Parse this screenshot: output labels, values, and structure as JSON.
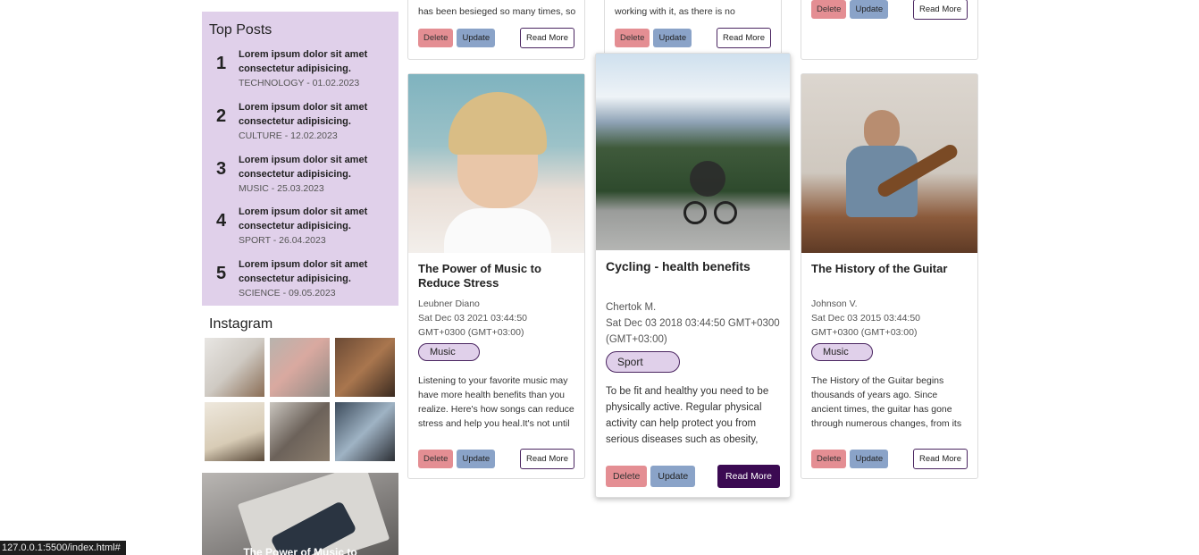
{
  "top_posts": {
    "heading": "Top Posts",
    "items": [
      {
        "num": "1",
        "title": "Lorem ipsum dolor sit amet consectetur adipisicing.",
        "meta": "TECHNOLOGY - 01.02.2023"
      },
      {
        "num": "2",
        "title": "Lorem ipsum dolor sit amet consectetur adipisicing.",
        "meta": "CULTURE - 12.02.2023"
      },
      {
        "num": "3",
        "title": "Lorem ipsum dolor sit amet consectetur adipisicing.",
        "meta": "MUSIC - 25.03.2023"
      },
      {
        "num": "4",
        "title": "Lorem ipsum dolor sit amet consectetur adipisicing.",
        "meta": "SPORT - 26.04.2023"
      },
      {
        "num": "5",
        "title": "Lorem ipsum dolor sit amet consectetur adipisicing.",
        "meta": "SCIENCE - 09.05.2023"
      }
    ]
  },
  "instagram": {
    "heading": "Instagram"
  },
  "feature": {
    "title": "The Power of Music to"
  },
  "top_cards": [
    {
      "excerpt": "has been besieged so many times, so"
    },
    {
      "excerpt": "working with it, as there is no"
    },
    {
      "excerpt": ""
    }
  ],
  "buttons": {
    "delete": "Delete",
    "update": "Update",
    "read_more": "Read More"
  },
  "cards": [
    {
      "title": "The Power of Music to Reduce Stress",
      "author": "Leubner Diano",
      "date": "Sat Dec 03 2021 03:44:50 GMT+0300 (GMT+03:00)",
      "tag": "Music",
      "excerpt": "Listening to your favorite music may have more health benefits than you realize. Here's how songs can reduce stress and help you heal.It's not until"
    },
    {
      "title": "Cycling - health benefits",
      "author": "Chertok M.",
      "date": "Sat Dec 03 2018 03:44:50 GMT+0300 (GMT+03:00)",
      "tag": "Sport",
      "excerpt": "To be fit and healthy you need to be physically active. Regular physical activity can help protect you from serious diseases such as obesity,"
    },
    {
      "title": "The History of the Guitar",
      "author": "Johnson V.",
      "date": "Sat Dec 03 2015 03:44:50 GMT+0300 (GMT+03:00)",
      "tag": "Music",
      "excerpt": "The History of the Guitar begins thousands of years ago. Since ancient times, the guitar has gone through numerous changes, from its"
    }
  ],
  "status_url": "127.0.0.1:5500/index.html#",
  "colors": {
    "sidebar_bg": "#e0d0ea",
    "delete": "#e48e93",
    "update": "#8aa3c8",
    "accent": "#3b0a52"
  }
}
